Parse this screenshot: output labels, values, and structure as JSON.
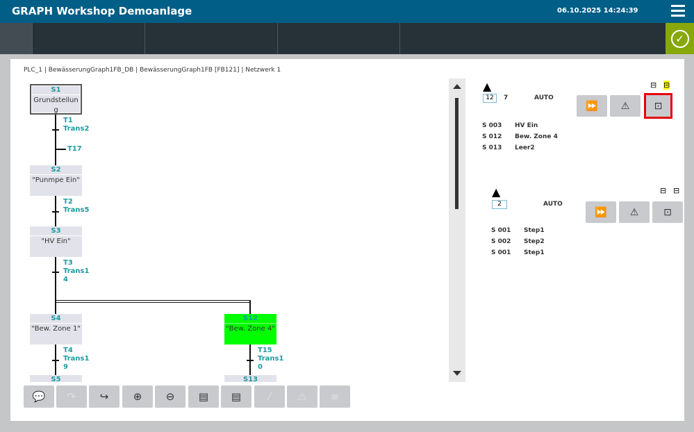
{
  "header": {
    "title": "GRAPH Workshop Demoanlage",
    "datetime": "06.10.2025 14:24:39"
  },
  "breadcrumb": "PLC_1 | BewässerungGraph1FB_DB | BewässerungGraph1FB [FB121] | Netzwerk 1",
  "steps": [
    {
      "num": "S1",
      "name": "Grundstellun",
      "name2": "g"
    },
    {
      "num": "S2",
      "name": "\"Punmpe Ein\""
    },
    {
      "num": "S3",
      "name": "\"HV Ein\""
    },
    {
      "num": "S4",
      "name": "\"Bew. Zone 1\""
    },
    {
      "num": "S12",
      "name": "\"Bew. Zone 4\"",
      "active": true
    },
    {
      "num": "S5"
    },
    {
      "num": "S13"
    }
  ],
  "transitions": [
    {
      "num": "T1",
      "name": "Trans2"
    },
    {
      "num": "T17"
    },
    {
      "num": "T2",
      "name": "Trans5"
    },
    {
      "num": "T3",
      "name": "Trans1",
      "name2": "4"
    },
    {
      "num": "T4",
      "name": "Trans1",
      "name2": "9"
    },
    {
      "num": "T15",
      "name": "Trans1",
      "name2": "0"
    }
  ],
  "colors": {
    "active": "#00ff00",
    "header": "#005e87",
    "highlight": "#e8000b"
  },
  "sequencers": [
    {
      "count": "12",
      "extra": "7",
      "mode": "AUTO",
      "rows": [
        [
          "S 003",
          "HV Ein"
        ],
        [
          "S 012",
          "Bew. Zone 4"
        ],
        [
          "S 013",
          "Leer2"
        ]
      ]
    },
    {
      "count": "2",
      "mode": "AUTO",
      "rows": [
        [
          "S 001",
          "Step1"
        ],
        [
          "S 002",
          "Step2"
        ],
        [
          "S 001",
          "Step1"
        ]
      ]
    }
  ],
  "toolbar_icons": [
    "comment-icon",
    "jump-back-icon",
    "jump-icon",
    "zoom-in-icon",
    "zoom-out-icon",
    "manual-mode-icon",
    "overview-zoom-icon",
    "transition-condition-icon",
    "supervision-icon",
    "interlock-icon"
  ]
}
